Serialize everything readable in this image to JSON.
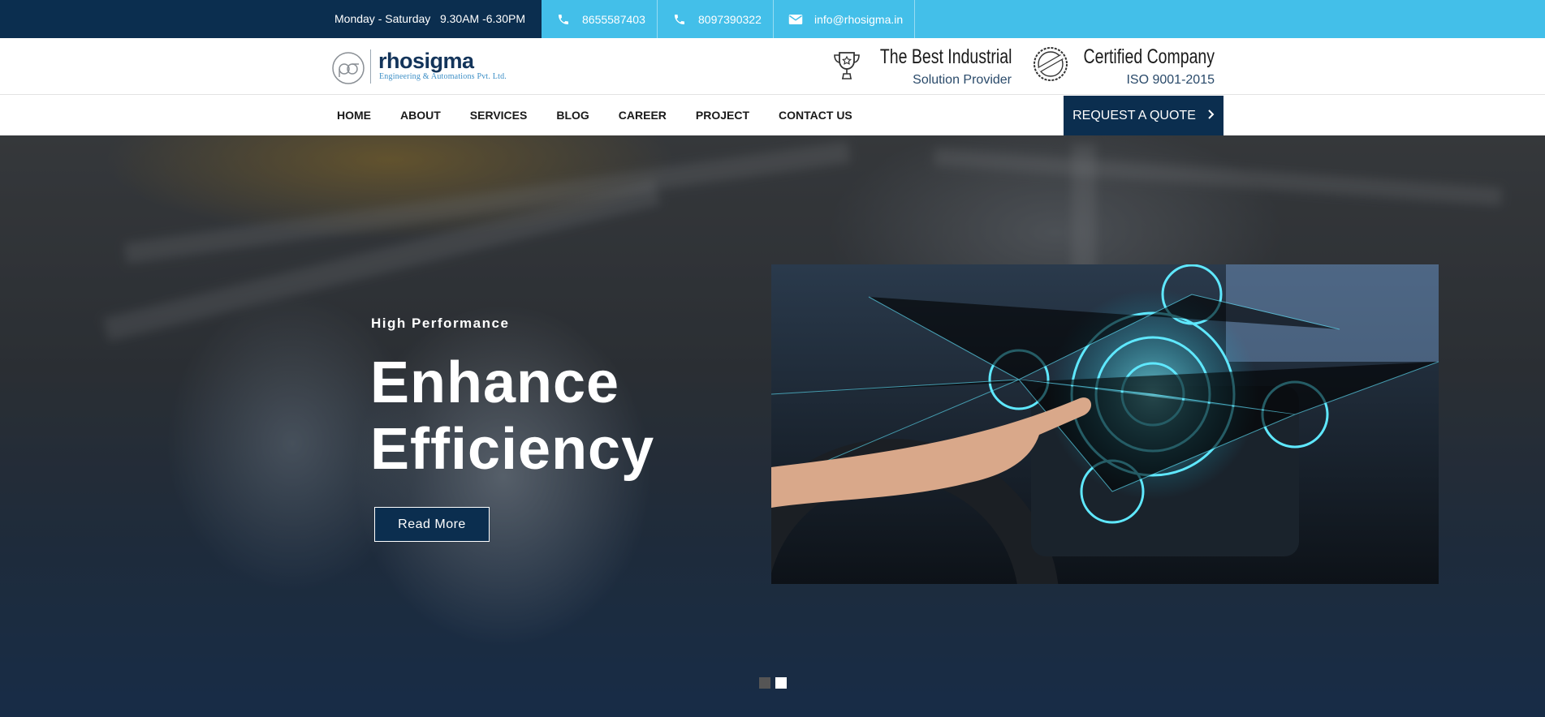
{
  "topbar": {
    "hours": "Monday - Saturday   9.30AM -6.30PM",
    "phone1": "8655587403",
    "phone2": "8097390322",
    "email": "info@rhosigma.in",
    "colors": {
      "dark": "#0b2e4f",
      "accent": "#43bfe9"
    }
  },
  "header": {
    "logo_name": "rhosigma",
    "logo_tagline": "Engineering & Automations Pvt. Ltd.",
    "badge1": {
      "icon": "trophy-icon",
      "title": "The Best Industrial",
      "subtitle": "Solution Provider"
    },
    "badge2": {
      "icon": "approved-stamp-icon",
      "title": "Certified Company",
      "subtitle": "ISO 9001-2015"
    }
  },
  "nav": {
    "items": [
      {
        "label": "HOME"
      },
      {
        "label": "ABOUT"
      },
      {
        "label": "SERVICES"
      },
      {
        "label": "BLOG"
      },
      {
        "label": "CAREER"
      },
      {
        "label": "PROJECT"
      },
      {
        "label": "CONTACT US"
      }
    ],
    "quote_label": "REQUEST A QUOTE",
    "quote_icon": "chevron-right-icon"
  },
  "hero": {
    "eyebrow": "High Performance",
    "title_line1": "Enhance",
    "title_line2": "Efficiency",
    "button_label": "Read More",
    "slides": [
      {
        "active": false
      },
      {
        "active": true
      }
    ]
  }
}
